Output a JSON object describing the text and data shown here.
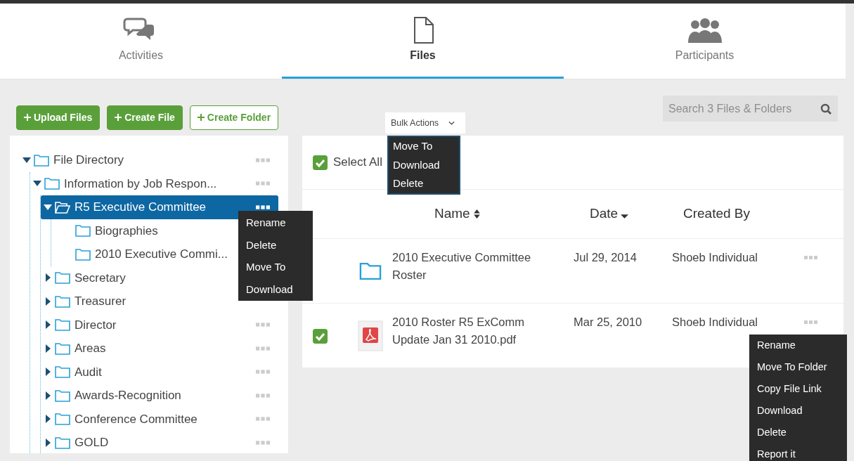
{
  "tabs": [
    {
      "label": "Activities",
      "kind": "chat",
      "selected": false
    },
    {
      "label": "Files",
      "kind": "file",
      "selected": true
    },
    {
      "label": "Participants",
      "kind": "people",
      "selected": false
    }
  ],
  "toolbar": {
    "buttons": [
      {
        "label": "Upload Files",
        "kind": "solid"
      },
      {
        "label": "Create File",
        "kind": "solid"
      },
      {
        "label": "Create Folder",
        "kind": "outline"
      }
    ],
    "search": {
      "placeholder": "Search 3 Files & Folders"
    }
  },
  "tree": [
    {
      "label": "File Directory",
      "expanded": true,
      "selected": false,
      "more_button": true,
      "children": [
        {
          "label": "Information by Job Respon...",
          "expanded": true,
          "selected": false,
          "more_button": true,
          "children": [
            {
              "label": "R5 Executive Committee",
              "expanded": true,
              "selected": true,
              "more_button": true,
              "children": [
                {
                  "label": "Biographies",
                  "selected": false
                },
                {
                  "label": "2010 Executive Commi...",
                  "selected": false
                }
              ]
            },
            {
              "label": "Secretary",
              "expanded": false,
              "selected": false
            },
            {
              "label": "Treasurer",
              "expanded": false,
              "selected": false
            },
            {
              "label": "Director",
              "expanded": false,
              "selected": false,
              "more_button": true
            },
            {
              "label": "Areas",
              "expanded": false,
              "selected": false,
              "more_button": true
            },
            {
              "label": "Audit",
              "expanded": false,
              "selected": false,
              "more_button": true
            },
            {
              "label": "Awards-Recognition",
              "expanded": false,
              "selected": false,
              "more_button": true
            },
            {
              "label": "Conference Committee",
              "expanded": false,
              "selected": false,
              "more_button": true
            },
            {
              "label": "GOLD",
              "expanded": false,
              "selected": false,
              "more_button": true
            }
          ]
        }
      ]
    }
  ],
  "tree_menu": [
    "Rename",
    "Delete",
    "Move To",
    "Download"
  ],
  "bulk_actions": {
    "label": "Bulk Actions",
    "items": [
      "Move To",
      "Download",
      "Delete"
    ]
  },
  "select_all": {
    "label": "Select All",
    "checked": true
  },
  "table": {
    "columns": [
      {
        "label": "Name",
        "kind": "sortable"
      },
      {
        "label": "Date",
        "kind": "sorted"
      },
      {
        "label": "Created By",
        "kind": "plain"
      }
    ],
    "rows": [
      {
        "kind": "folder",
        "checked": false,
        "name": "2010 Executive Committee Roster",
        "date": "Jul 29, 2014",
        "created_by": "Shoeb Individual"
      },
      {
        "kind": "pdf",
        "checked": true,
        "name": "2010 Roster R5 ExComm Update Jan 31 2010.pdf",
        "date": "Mar 25, 2010",
        "created_by": "Shoeb Individual"
      }
    ]
  },
  "row_menu": [
    "Rename",
    "Move To Folder",
    "Copy File Link",
    "Download",
    "Delete",
    "Report it"
  ]
}
